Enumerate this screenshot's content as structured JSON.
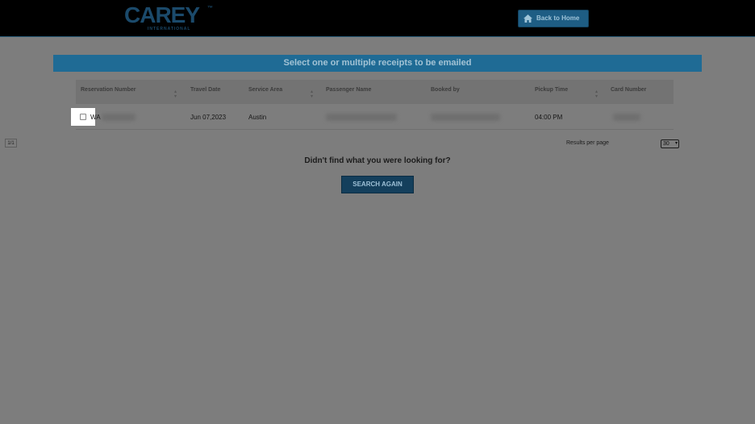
{
  "header": {
    "logo_text": "CAREY",
    "logo_tm": "™",
    "logo_sub": "INTERNATIONAL",
    "home_button": "Back to Home"
  },
  "banner": {
    "title": "Select one or multiple receipts to be emailed"
  },
  "table": {
    "columns": [
      "Reservation Number",
      "Travel Date",
      "Service Area",
      "Passenger Name",
      "Booked by",
      "Pickup Time",
      "Card Number"
    ],
    "rows": [
      {
        "reservation_prefix": "WA",
        "travel_date": "Jun 07,2023",
        "service_area": "Austin",
        "pickup_time": "04:00 PM"
      }
    ]
  },
  "pager": {
    "page_indicator": "1/1"
  },
  "results_per_page": {
    "label": "Results per page",
    "selected": "30"
  },
  "not_found": {
    "message": "Didn't find what you were looking for?",
    "button": "SEARCH AGAIN"
  },
  "colors": {
    "overlay": "#7d7d7d",
    "banner": "#1f6b95",
    "button": "#143f5c"
  },
  "icons": {
    "home": "home-icon",
    "sort": "sort-arrows-icon"
  }
}
